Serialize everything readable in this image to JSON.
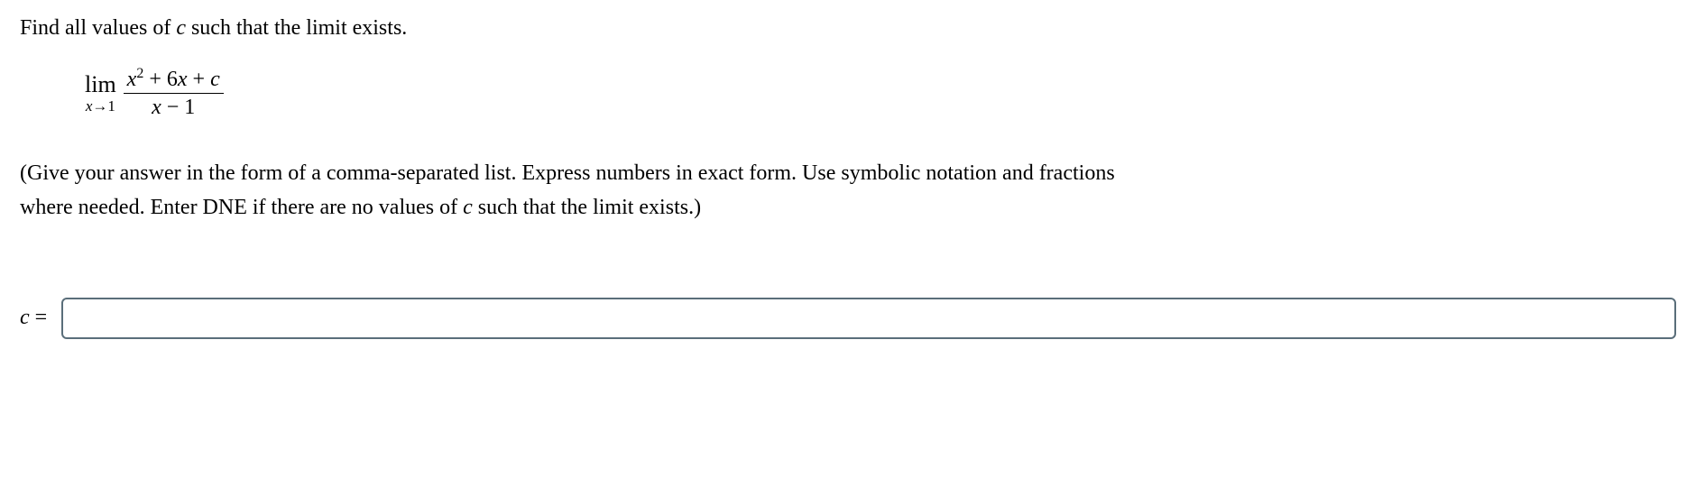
{
  "problem": {
    "statement_prefix": "Find all values of ",
    "statement_var": "c",
    "statement_suffix": " such that the limit exists."
  },
  "math": {
    "lim_label": "lim",
    "lim_approach_var": "x",
    "lim_approach_arrow": "→",
    "lim_approach_value": "1",
    "numerator_x": "x",
    "numerator_exp": "2",
    "numerator_rest": " + 6",
    "numerator_x2": "x",
    "numerator_plus": " + ",
    "numerator_c": "c",
    "denominator_x": "x",
    "denominator_rest": " − 1"
  },
  "instructions": {
    "line1_prefix": "(Give your answer in the form of a comma-separated list. Express numbers in exact form. Use symbolic notation and fractions",
    "line2_prefix": "where needed. Enter DNE if there are no values of ",
    "line2_var": "c",
    "line2_suffix": " such that the limit exists.)"
  },
  "answer": {
    "label_var": "c",
    "label_equals": " =",
    "input_value": ""
  }
}
